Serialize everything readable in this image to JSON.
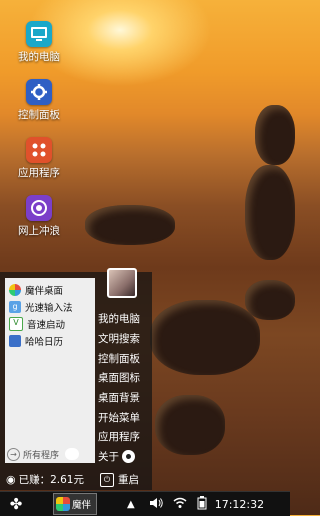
{
  "desktop_icons": [
    {
      "label": "我的电脑",
      "icon": "monitor-icon",
      "color": "#1aa8c9"
    },
    {
      "label": "控制面板",
      "icon": "gear-icon",
      "color": "#2f5fc4"
    },
    {
      "label": "应用程序",
      "icon": "apps-grid-icon",
      "color": "#e0512b"
    },
    {
      "label": "网上冲浪",
      "icon": "browser-icon",
      "color": "#7b3fc9"
    }
  ],
  "start_menu": {
    "apps": [
      {
        "label": "魔伴桌面",
        "icon": "mofeng-icon"
      },
      {
        "label": "光速输入法",
        "icon": "input-method-icon"
      },
      {
        "label": "音速启动",
        "icon": "quick-launch-icon"
      },
      {
        "label": "哈哈日历",
        "icon": "calendar-icon"
      }
    ],
    "all_apps_label": "所有程序",
    "system_items": [
      "我的电脑",
      "文明搜索",
      "控制面板",
      "桌面图标",
      "桌面背景",
      "开始菜单",
      "应用程序",
      "关于"
    ],
    "earnings": "已赚：2.61元",
    "restart_label": "重启"
  },
  "taskbar": {
    "task_label": "魔伴",
    "clock": "17:12:32"
  }
}
